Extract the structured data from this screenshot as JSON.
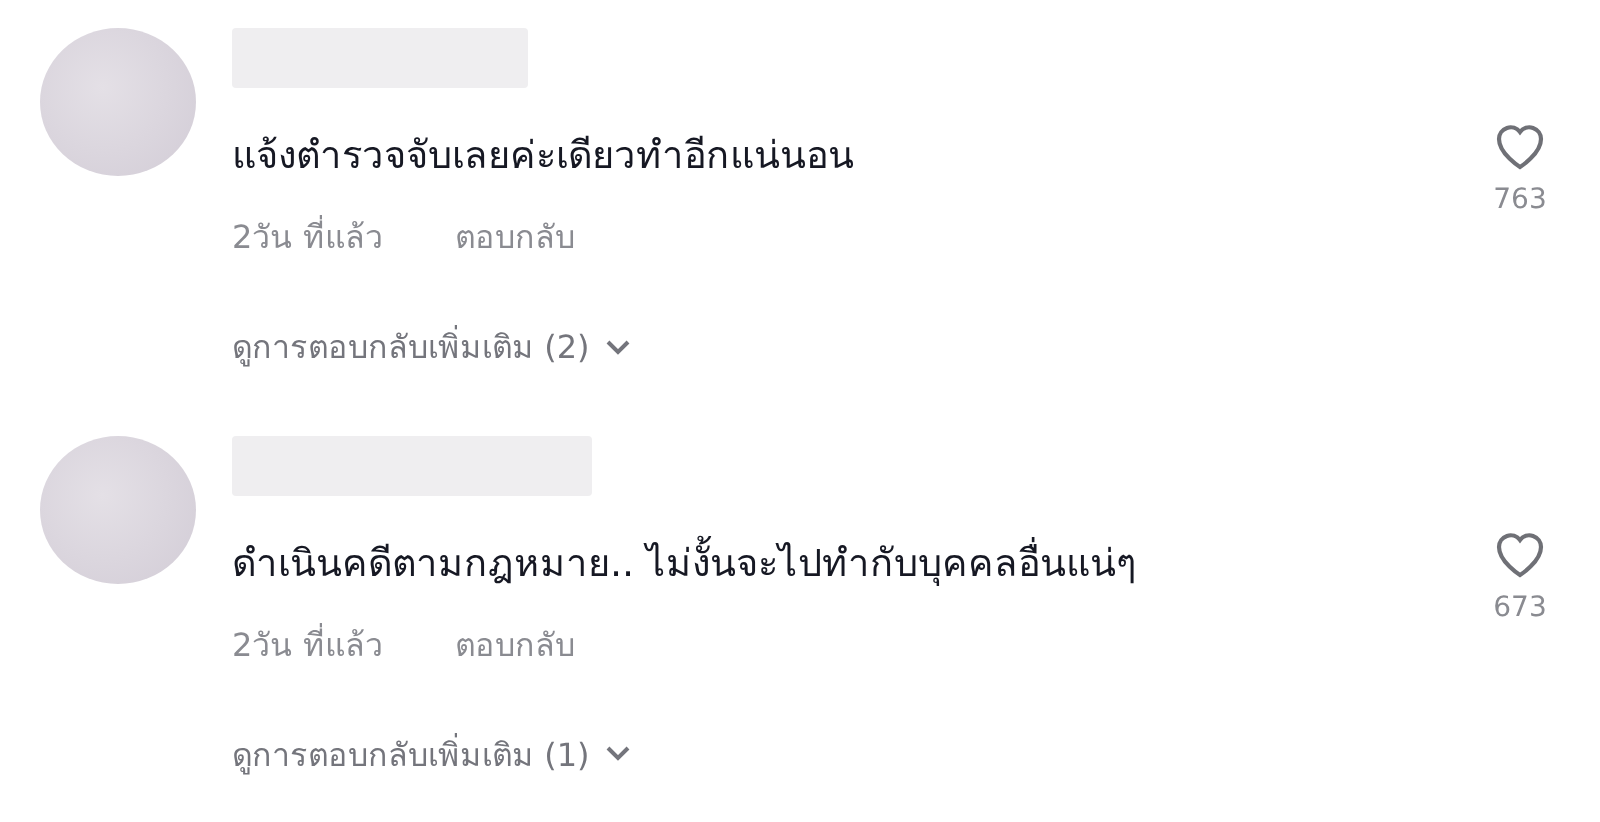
{
  "comments": [
    {
      "text": "แจ้งตำรวจจับเลยค่ะเดียวทำอีกแน่นอน",
      "time": "2วัน ที่แล้ว",
      "reply": "ตอบกลับ",
      "likes": "763",
      "more_replies": "ดูการตอบกลับเพิ่มเติม (2)",
      "liked": false
    },
    {
      "text": "ดำเนินคดีตามกฎหมาย.. ไม่งั้นจะไปทำกับบุคคลอื่นแน่ๆ",
      "time": "2วัน ที่แล้ว",
      "reply": "ตอบกลับ",
      "likes": "673",
      "more_replies": "ดูการตอบกลับเพิ่มเติม (1)",
      "liked": false
    }
  ]
}
